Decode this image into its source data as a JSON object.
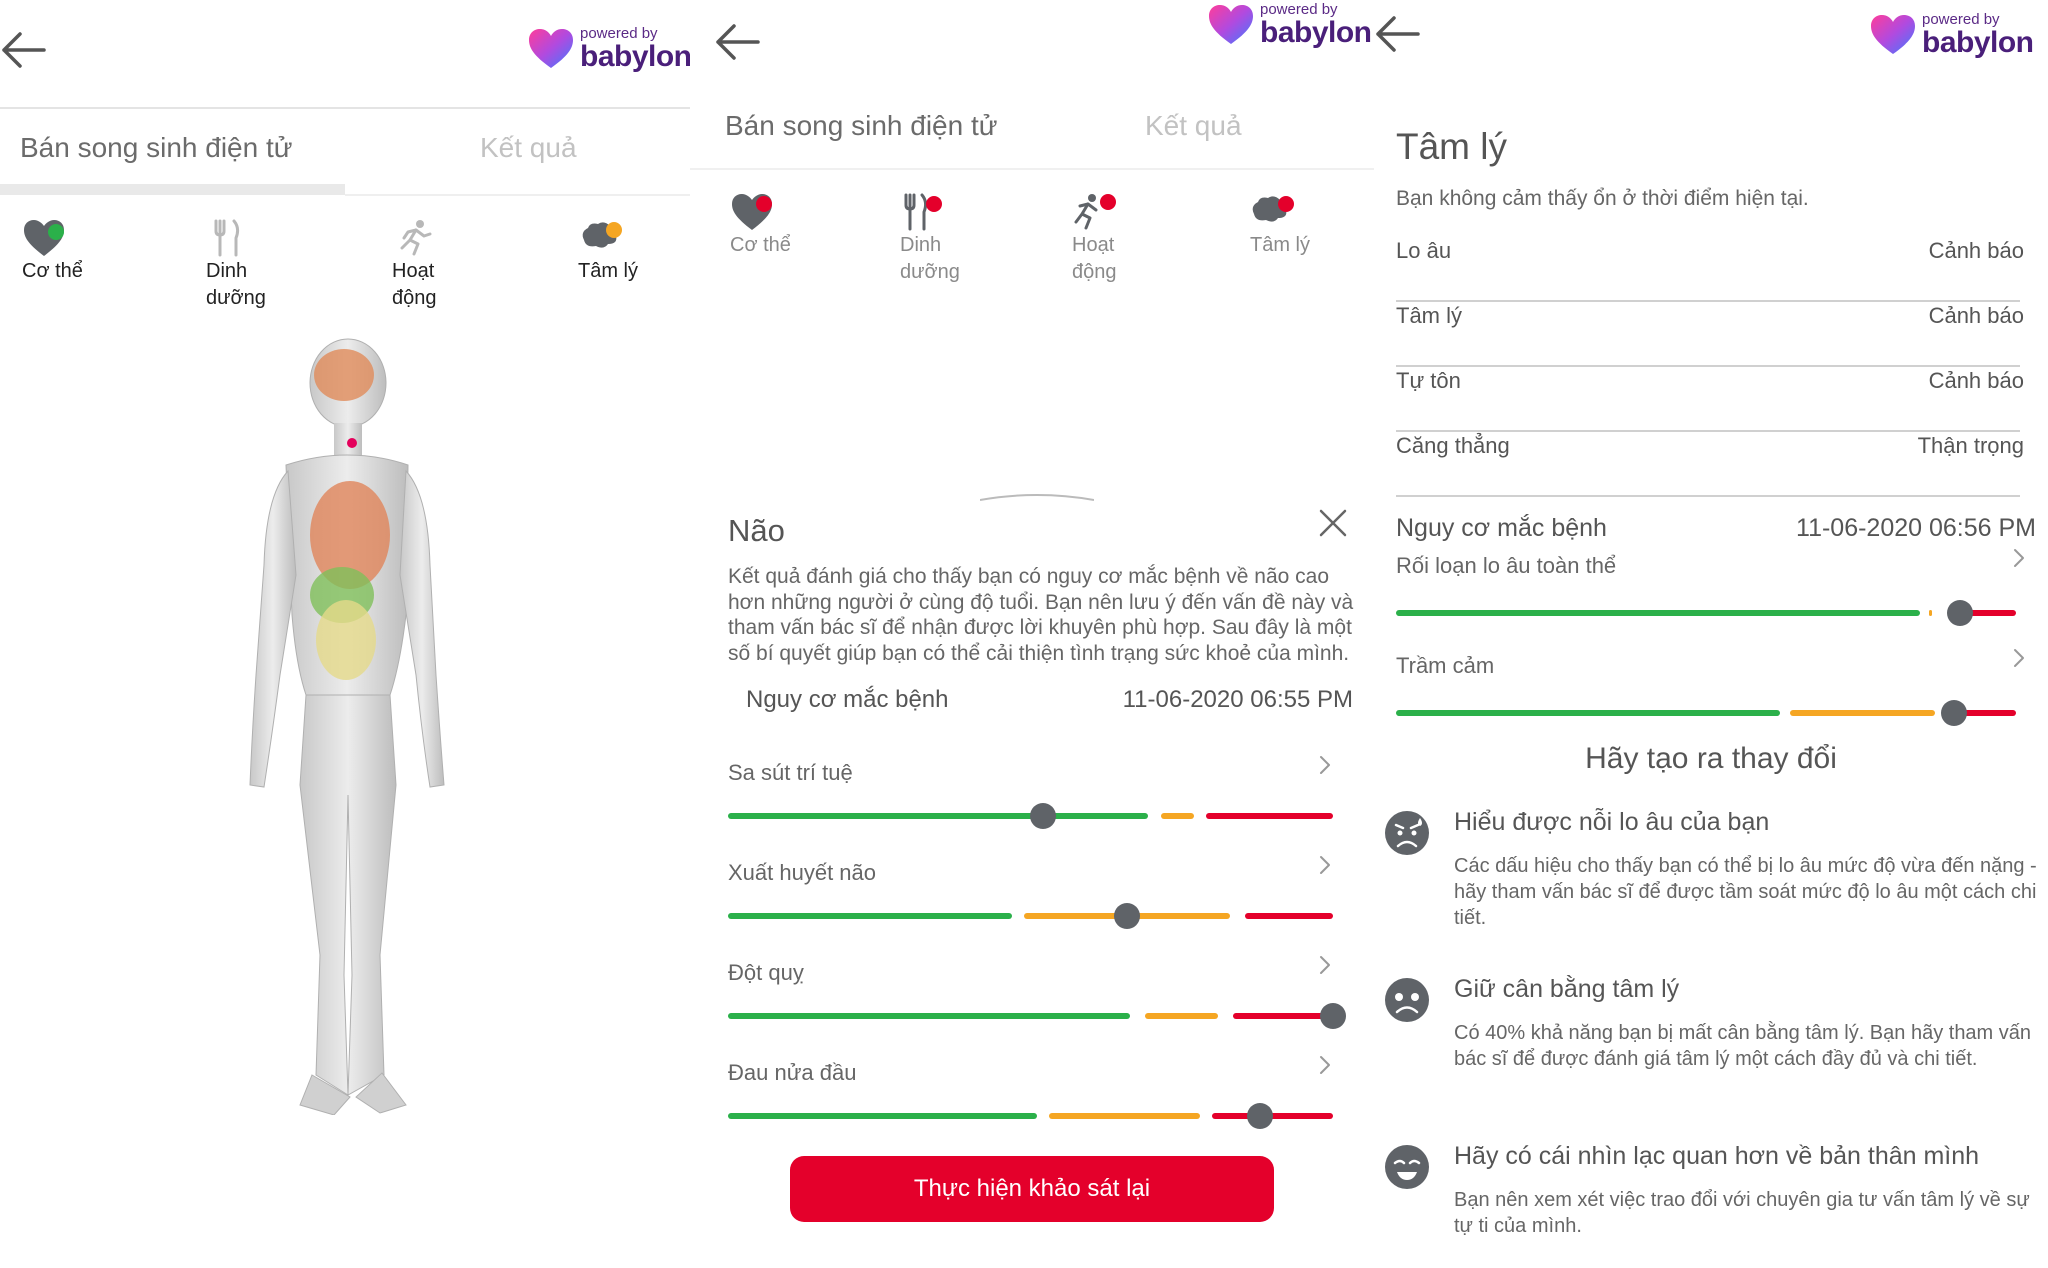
{
  "brand": {
    "powered_by": "powered by",
    "name": "babylon"
  },
  "tabs": {
    "digital_twin": "Bán song sinh điện tử",
    "results": "Kết quả"
  },
  "categories": [
    {
      "label": "Cơ thể",
      "icon": "heart-icon"
    },
    {
      "label": "Dinh\ndưỡng",
      "icon": "fork-knife-icon"
    },
    {
      "label": "Hoạt\nđộng",
      "icon": "running-icon"
    },
    {
      "label": "Tâm lý",
      "icon": "brain-icon"
    }
  ],
  "colors": {
    "green": "#2bb04a",
    "orange": "#f5a623",
    "red": "#e4002b",
    "knob": "#5f6368",
    "brand_purple": "#4a1f7a"
  },
  "brain_sheet": {
    "title": "Não",
    "description": "Kết quả đánh giá cho thấy bạn có nguy cơ mắc bệnh về não cao hơn những người ở cùng độ tuổi. Bạn nên lưu ý đến vấn đề này và tham vấn bác sĩ để nhận được lời khuyên phù hợp. Sau đây là một số bí quyết giúp bạn có thể cải thiện tình trạng sức khoẻ của mình.",
    "risk_label": "Nguy cơ mắc bệnh",
    "timestamp": "11-06-2020 06:55 PM",
    "risks": [
      {
        "name": "Sa sút trí tuệ",
        "level": 0.52
      },
      {
        "name": "Xuất huyết não",
        "level": 0.66
      },
      {
        "name": "Đột quỵ",
        "level": 1.0
      },
      {
        "name": "Đau nửa đầu",
        "level": 0.88
      }
    ],
    "retake_button": "Thực hiện khảo sát lại"
  },
  "psych": {
    "title": "Tâm lý",
    "subtitle": "Bạn không cảm thấy ổn ở thời điểm hiện tại.",
    "rows": [
      {
        "name": "Lo âu",
        "status": "Cảnh báo"
      },
      {
        "name": "Tâm lý",
        "status": "Cảnh báo"
      },
      {
        "name": "Tự tôn",
        "status": "Cảnh báo"
      },
      {
        "name": "Căng thẳng",
        "status": "Thận trọng"
      }
    ],
    "risk_label": "Nguy cơ mắc bệnh",
    "timestamp": "11-06-2020 06:56 PM",
    "risks": [
      {
        "name": "Rối loạn lo âu toàn thể",
        "level": 0.91
      },
      {
        "name": "Trầm cảm",
        "level": 0.9
      }
    ],
    "change_title": "Hãy tạo ra thay đổi",
    "tips": [
      {
        "icon": "worried-face-icon",
        "title": "Hiểu được nỗi lo âu của bạn",
        "body": "Các dấu hiệu cho thấy bạn có thể bị lo âu mức độ vừa đến nặng - hãy tham vấn bác sĩ để được tầm soát mức độ lo âu một cách chi tiết."
      },
      {
        "icon": "sad-face-icon",
        "title": "Giữ cân bằng tâm lý",
        "body": "Có 40% khả năng bạn bị mất cân bằng tâm lý. Bạn hãy tham vấn bác sĩ để được đánh giá tâm lý một cách đầy đủ và chi tiết."
      },
      {
        "icon": "neutral-face-icon",
        "title": "Hãy có cái nhìn lạc quan hơn về bản thân mình",
        "body": "Bạn nên xem xét việc trao đổi với chuyên gia tư vấn tâm lý về sự tự ti của mình."
      }
    ]
  }
}
